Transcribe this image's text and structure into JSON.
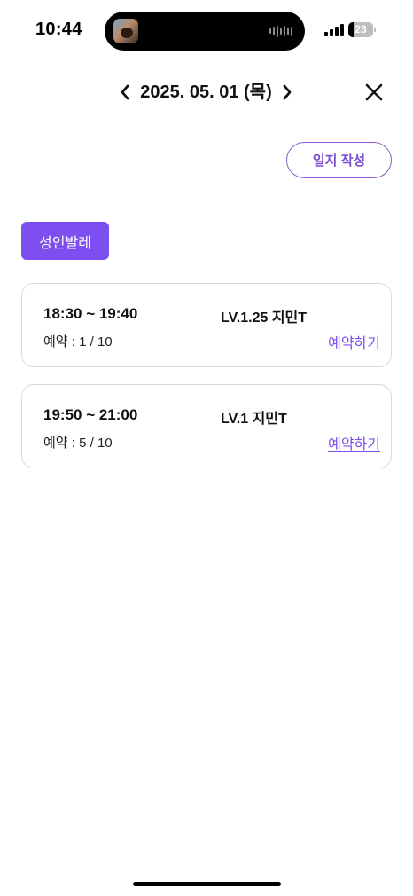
{
  "status_bar": {
    "time": "10:44",
    "battery_percent": "23",
    "battery_level": 0.23
  },
  "header": {
    "date": "2025. 05. 01 (목)",
    "prev_icon": "chevron-left-icon",
    "next_icon": "chevron-right-icon",
    "close_icon": "close-icon"
  },
  "journal_button": {
    "label": "일지 작성"
  },
  "category": {
    "label": "성인발레"
  },
  "classes": [
    {
      "time": "18:30 ~ 19:40",
      "level": "LV.1.25 지민T",
      "booking": "예약 : 1 / 10",
      "action": "예약하기"
    },
    {
      "time": "19:50 ~ 21:00",
      "level": "LV.1 지민T",
      "booking": "예약 : 5 / 10",
      "action": "예약하기"
    }
  ],
  "colors": {
    "accent": "#7d4ff0",
    "journal_border": "#8a5cd6",
    "card_border": "#d9d9d9"
  }
}
